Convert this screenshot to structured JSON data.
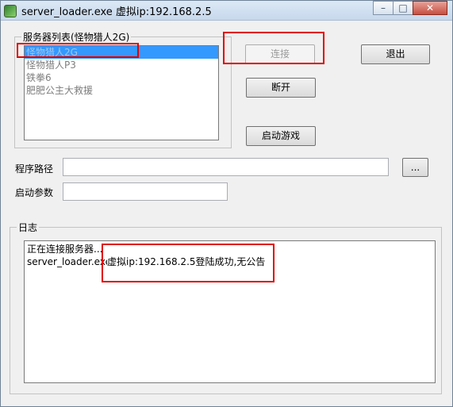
{
  "window": {
    "title": "server_loader.exe 虚拟ip:192.168.2.5",
    "minimize_glyph": "–",
    "maximize_glyph": "□",
    "close_glyph": "✕"
  },
  "server_list": {
    "group_label": "服务器列表(怪物猎人2G)",
    "items": [
      "怪物猎人2G",
      "怪物猎人P3",
      "铁拳6",
      "肥肥公主大救援"
    ],
    "selected_index": 0
  },
  "buttons": {
    "connect": "连接",
    "disconnect": "断开",
    "exit": "退出",
    "start_game": "启动游戏",
    "browse": "..."
  },
  "path": {
    "label": "程序路径",
    "value": ""
  },
  "params": {
    "label": "启动参数",
    "value": ""
  },
  "log": {
    "group_label": "日志",
    "lines": [
      "正在连接服务器...",
      "server_loader.exe"
    ],
    "annotation": "虚拟ip:192.168.2.5登陆成功,无公告"
  },
  "colors": {
    "annotation_border": "#e00000",
    "selection": "#3399ff"
  }
}
